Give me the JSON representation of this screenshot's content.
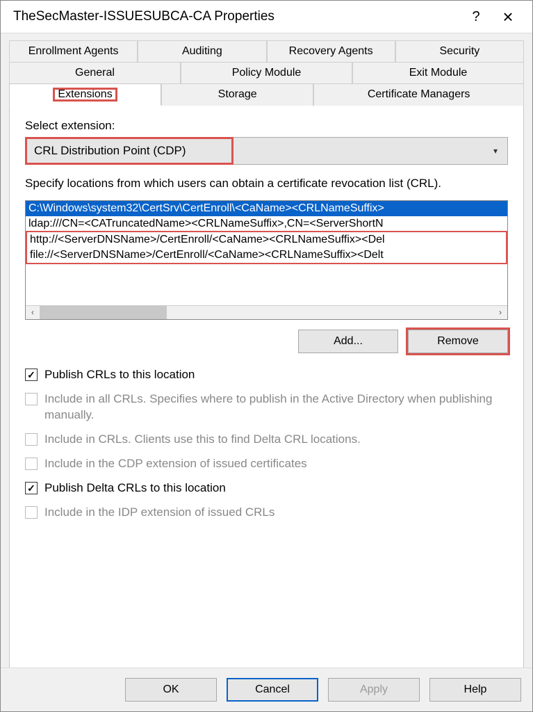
{
  "window": {
    "title": "TheSecMaster-ISSUESUBCA-CA Properties",
    "help": "?",
    "close": "×"
  },
  "tabs": {
    "row1": [
      "Enrollment Agents",
      "Auditing",
      "Recovery Agents",
      "Security"
    ],
    "row2": [
      "General",
      "Policy Module",
      "Exit Module"
    ],
    "row3": [
      "Extensions",
      "Storage",
      "Certificate Managers"
    ]
  },
  "ext": {
    "select_label": "Select extension:",
    "dropdown_value": "CRL Distribution Point (CDP)",
    "desc": "Specify locations from which users can obtain a certificate revocation list (CRL).",
    "items": [
      "C:\\Windows\\system32\\CertSrv\\CertEnroll\\<CaName><CRLNameSuffix>",
      "ldap:///CN=<CATruncatedName><CRLNameSuffix>,CN=<ServerShortN",
      "http://<ServerDNSName>/CertEnroll/<CaName><CRLNameSuffix><Del",
      "file://<ServerDNSName>/CertEnroll/<CaName><CRLNameSuffix><Delt"
    ],
    "add": "Add...",
    "remove": "Remove"
  },
  "checks": {
    "c1": "Publish CRLs to this location",
    "c2": "Include in all CRLs. Specifies where to publish in the Active Directory when publishing manually.",
    "c3": "Include in CRLs. Clients use this to find Delta CRL locations.",
    "c4": "Include in the CDP extension of issued certificates",
    "c5": "Publish Delta CRLs to this location",
    "c6": "Include in the IDP extension of issued CRLs"
  },
  "footer": {
    "ok": "OK",
    "cancel": "Cancel",
    "apply": "Apply",
    "help": "Help"
  }
}
